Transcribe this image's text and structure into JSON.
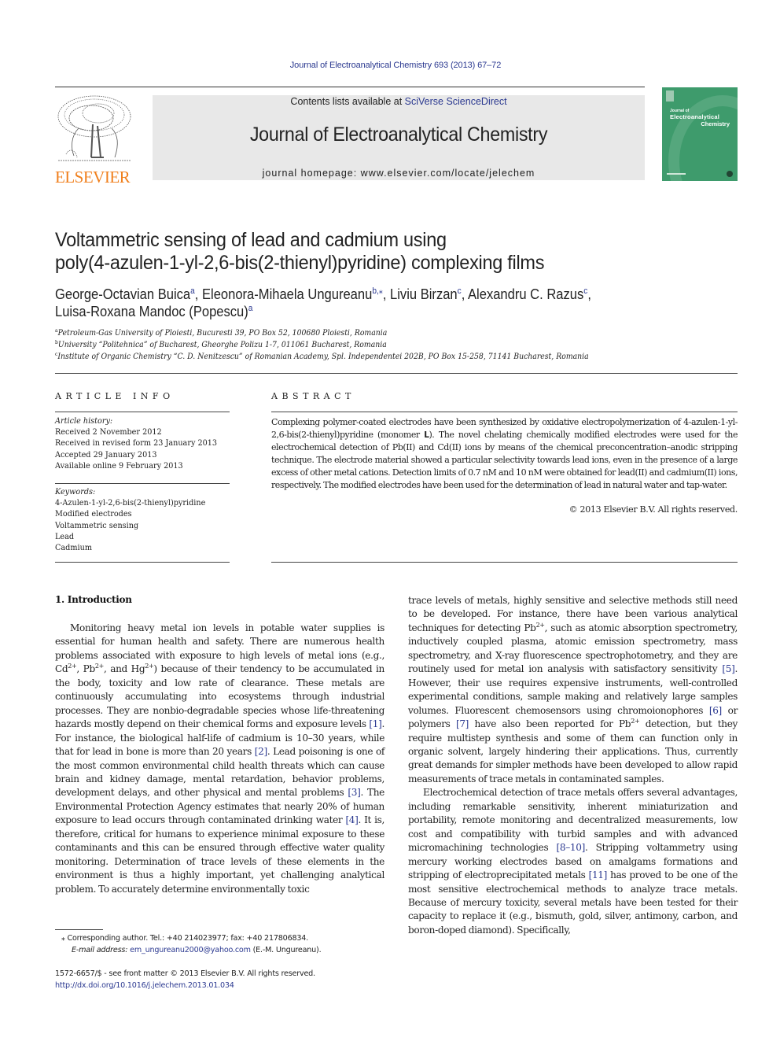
{
  "running_head": "Journal of Electroanalytical Chemistry 693 (2013) 67–72",
  "publisher": {
    "logo_word": "ELSEVIER",
    "brand_color": "#f07f1c"
  },
  "banner": {
    "contents_prefix": "Contents lists available at ",
    "contents_link": "SciVerse ScienceDirect",
    "journal_title": "Journal of Electroanalytical Chemistry",
    "homepage": "journal homepage: www.elsevier.com/locate/jelechem"
  },
  "cover": {
    "line1": "Journal of",
    "line2": "Electroanalytical",
    "line3": "Chemistry",
    "color": "#3e9b6c"
  },
  "article": {
    "title_line1": "Voltammetric sensing of lead and cadmium using",
    "title_line2": "poly(4-azulen-1-yl-2,6-bis(2-thienyl)pyridine) complexing films",
    "authors": [
      {
        "name": "George-Octavian Buica",
        "sup": "a",
        "sep": ", "
      },
      {
        "name": "Eleonora-Mihaela Ungureanu",
        "sup": "b,⁎",
        "sep": ", "
      },
      {
        "name": "Liviu Birzan",
        "sup": "c",
        "sep": ", "
      },
      {
        "name": "Alexandru C. Razus",
        "sup": "c",
        "sep": ","
      },
      {
        "name": "Luisa-Roxana Mandoc (Popescu)",
        "sup": "a",
        "sep": ""
      }
    ],
    "affiliations": [
      {
        "sup": "a",
        "text": "Petroleum-Gas University of Ploiesti, Bucuresti 39, PO Box 52, 100680 Ploiesti, Romania"
      },
      {
        "sup": "b",
        "text": "University “Politehnica” of Bucharest, Gheorghe Polizu 1-7, 011061 Bucharest, Romania"
      },
      {
        "sup": "c",
        "text": "Institute of Organic Chemistry “C. D. Nenitzescu” of Romanian Academy, Spl. Independentei 202B, PO Box 15-258, 71141 Bucharest, Romania"
      }
    ]
  },
  "article_info": {
    "heading": "ARTICLE INFO",
    "history_label": "Article history:",
    "history": [
      "Received 2 November 2012",
      "Received in revised form 23 January 2013",
      "Accepted 29 January 2013",
      "Available online 9 February 2013"
    ],
    "keywords_label": "Keywords:",
    "keywords": [
      "4-Azulen-1-yl-2,6-bis(2-thienyl)pyridine",
      "Modified electrodes",
      "Voltammetric sensing",
      "Lead",
      "Cadmium"
    ]
  },
  "abstract": {
    "heading": "ABSTRACT",
    "text_before_bold": "Complexing polymer-coated electrodes have been synthesized by oxidative electropolymerization of 4-azulen-1-yl-2,6-bis(2-thienyl)pyridine (monomer ",
    "bold": "L",
    "text_after_bold": "). The novel chelating chemically modified electrodes were used for the electrochemical detection of Pb(II) and Cd(II) ions by means of the chemical preconcentration–anodic stripping technique. The electrode material showed a particular selectivity towards lead ions, even in the presence of a large excess of other metal cations. Detection limits of 0.7 nM and 10 nM were obtained for lead(II) and cadmium(II) ions, respectively. The modified electrodes have been used for the determination of lead in natural water and tap-water.",
    "copyright": "© 2013 Elsevier B.V. All rights reserved."
  },
  "introduction": {
    "heading": "1. Introduction",
    "left_p1": [
      {
        "t": "Monitoring heavy metal ion levels in potable water supplies is essential for human health and safety. There are numerous health problems associated with exposure to high levels of metal ions (e.g., Cd"
      },
      {
        "sup": "2+"
      },
      {
        "t": ", Pb"
      },
      {
        "sup": "2+"
      },
      {
        "t": ", and Hg"
      },
      {
        "sup": "2+"
      },
      {
        "t": ") because of their tendency to be accumulated in the body, toxicity and low rate of clearance. These metals are continuously accumulating into ecosystems through industrial processes. They are nonbio-degradable species whose life-threatening hazards mostly depend on their chemical forms and exposure levels "
      },
      {
        "ref": "[1]"
      },
      {
        "t": ". For instance, the biological half-life of cadmium is 10–30 years, while that for lead in bone is more than 20 years "
      },
      {
        "ref": "[2]"
      },
      {
        "t": ". Lead poisoning is one of the most common environmental child health threats which can cause brain and kidney damage, mental retardation, behavior problems, development delays, and other physical and mental problems "
      },
      {
        "ref": "[3]"
      },
      {
        "t": ". The Environmental Protection Agency estimates that nearly 20% of human exposure to lead occurs through contaminated drinking water "
      },
      {
        "ref": "[4]"
      },
      {
        "t": ". It is, therefore, critical for humans to experience minimal exposure to these contaminants and this can be ensured through effective water quality monitoring. Determination of trace levels of these elements in the environment is thus a highly important, yet challenging analytical problem. To accurately determine environmentally toxic"
      }
    ],
    "right_p1": [
      {
        "t": "trace levels of metals, highly sensitive and selective methods still need to be developed. For instance, there have been various analytical techniques for detecting Pb"
      },
      {
        "sup": "2+"
      },
      {
        "t": ", such as atomic absorption spectrometry, inductively coupled plasma, atomic emission spectrometry, mass spectrometry, and X-ray fluorescence spectrophotometry, and they are routinely used for metal ion analysis with satisfactory sensitivity "
      },
      {
        "ref": "[5]"
      },
      {
        "t": ". However, their use requires expensive instruments, well-controlled experimental conditions, sample making and relatively large samples volumes. Fluorescent chemosensors using chromoionophores "
      },
      {
        "ref": "[6]"
      },
      {
        "t": " or polymers "
      },
      {
        "ref": "[7]"
      },
      {
        "t": " have also been reported for Pb"
      },
      {
        "sup": "2+"
      },
      {
        "t": " detection, but they require multistep synthesis and some of them can function only in organic solvent, largely hindering their applications. Thus, currently great demands for simpler methods have been developed to allow rapid measurements of trace metals in contaminated samples."
      }
    ],
    "right_p2": [
      {
        "t": "Electrochemical detection of trace metals offers several advantages, including remarkable sensitivity, inherent miniaturization and portability, remote monitoring and decentralized measurements, low cost and compatibility with turbid samples and with advanced micromachining technologies "
      },
      {
        "ref": "[8–10]"
      },
      {
        "t": ". Stripping voltammetry using mercury working electrodes based on amalgams formations and stripping of electroprecipitated metals "
      },
      {
        "ref": "[11]"
      },
      {
        "t": " has proved to be one of the most sensitive electrochemical methods to analyze trace metals. Because of mercury toxicity, several metals have been tested for their capacity to replace it (e.g., bismuth, gold, silver, antimony, carbon, and boron-doped diamond). Specifically,"
      }
    ]
  },
  "footnotes": {
    "star": "⁎",
    "corresponding": "Corresponding author. Tel.: +40 214023977; fax: +40 217806834.",
    "email_label": "E-mail address:",
    "email": "em_ungureanu2000@yahoo.com",
    "email_suffix": " (E.-M. Ungureanu).",
    "issn": "1572-6657/$ - see front matter © 2013 Elsevier B.V. All rights reserved.",
    "doi": "http://dx.doi.org/10.1016/j.jelechem.2013.01.034"
  }
}
